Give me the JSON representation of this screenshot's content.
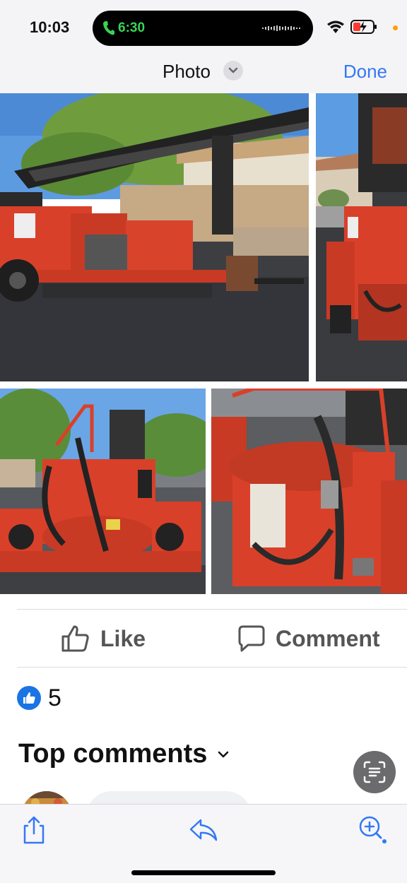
{
  "status_bar": {
    "time": "10:03",
    "call_duration": "6:30",
    "call_color": "#39d353",
    "privacy_dot_color": "#ff9f0a"
  },
  "header": {
    "title": "Photo",
    "done_label": "Done",
    "accent_color": "#3478f6"
  },
  "photos": [
    {
      "subject": "red-trailer-side-view"
    },
    {
      "subject": "red-trailer-partial-view"
    },
    {
      "subject": "red-kettle-rear-view"
    },
    {
      "subject": "red-kettle-closeup"
    }
  ],
  "actions": {
    "like_label": "Like",
    "comment_label": "Comment"
  },
  "reactions": {
    "count": "5",
    "icon": "thumbs-up-icon",
    "badge_color": "#1b74e4"
  },
  "comments_section": {
    "title": "Top comments"
  },
  "toolbar": {
    "icons": [
      "share-icon",
      "reply-icon",
      "zoom-in-icon"
    ]
  }
}
